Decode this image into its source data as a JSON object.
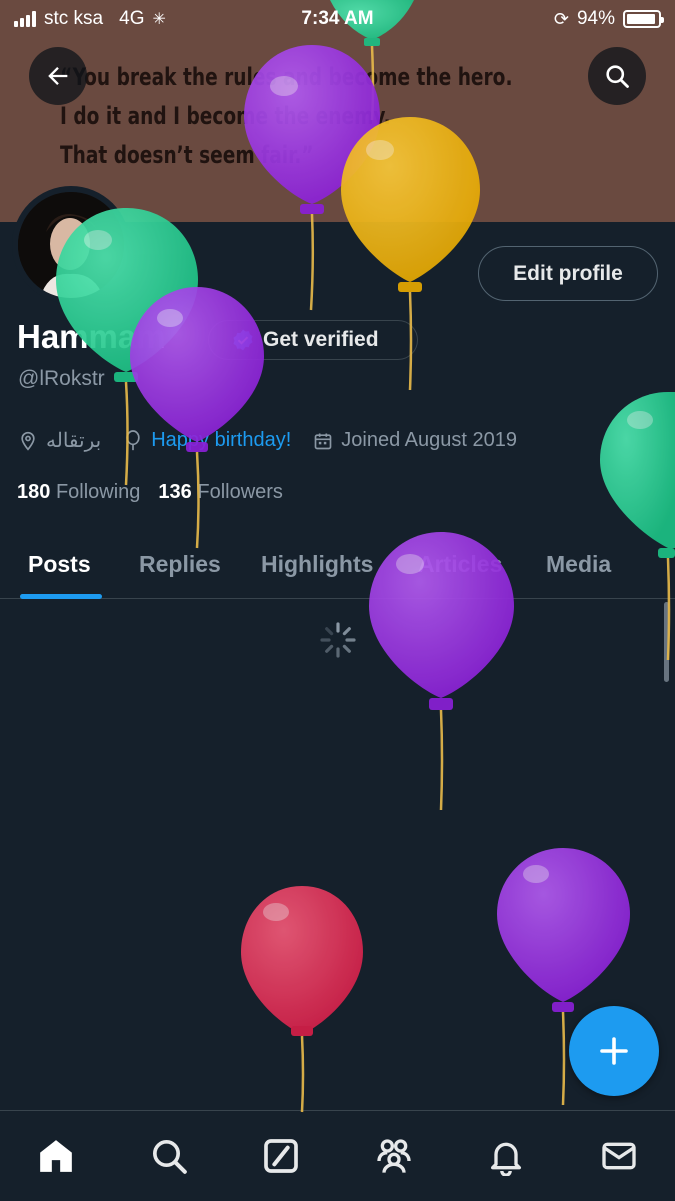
{
  "status_bar": {
    "carrier": "stc ksa",
    "network": "4G",
    "time": "7:34 AM",
    "battery": "94%"
  },
  "banner": {
    "quote_lines": [
      "“You break the rules and become the hero.",
      "I do it and I become the enemy.",
      "That doesn’t seem fair.”"
    ]
  },
  "profile": {
    "name": "Hammam",
    "verify_label": "Get verified",
    "handle": "@lRokstr",
    "edit_label": "Edit profile",
    "location": "برتقاله",
    "birthday": "Happy birthday!",
    "joined": "Joined August 2019",
    "following_count": "180",
    "following_label": "Following",
    "followers_count": "136",
    "followers_label": "Followers"
  },
  "tabs": [
    {
      "label": "Posts",
      "active": true
    },
    {
      "label": "Replies",
      "active": false
    },
    {
      "label": "Highlights",
      "active": false
    },
    {
      "label": "Articles",
      "active": false
    },
    {
      "label": "Media",
      "active": false
    }
  ],
  "icons": {
    "back": "back-arrow-icon",
    "search": "search-icon",
    "compose": "plus-icon",
    "nav": [
      "home-icon",
      "search-icon",
      "grok-icon",
      "communities-icon",
      "notifications-icon",
      "messages-icon"
    ]
  },
  "colors": {
    "accent": "#1d9bf0",
    "background": "#15202b",
    "balloon_purple": "#9b30e0",
    "balloon_green": "#2ed69a",
    "balloon_yellow": "#f2b616",
    "balloon_red": "#e8305a"
  }
}
